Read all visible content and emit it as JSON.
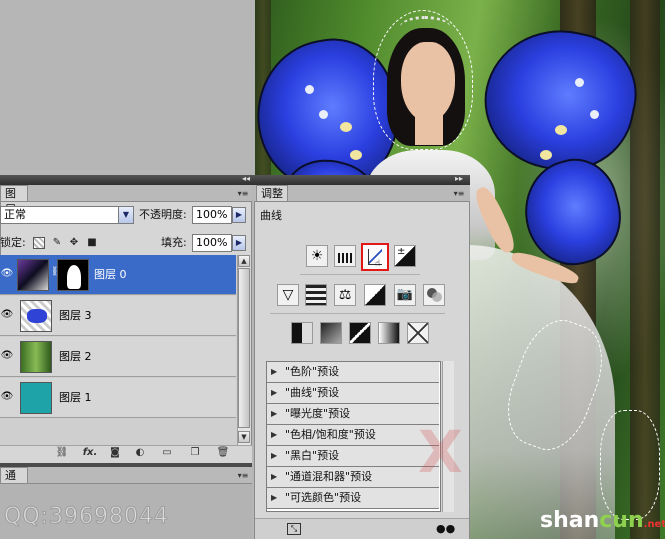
{
  "layers_panel": {
    "tab_label": "图层",
    "blend_mode": "正常",
    "opacity_label": "不透明度:",
    "opacity_value": "100%",
    "lock_label": "锁定:",
    "fill_label": "填充:",
    "fill_value": "100%",
    "layers": [
      {
        "name": "图层 0",
        "selected": true
      },
      {
        "name": "图层 3",
        "selected": false
      },
      {
        "name": "图层 2",
        "selected": false
      },
      {
        "name": "图层 1",
        "selected": false
      }
    ],
    "thumb_colors": {
      "layer1": "#1ea3a8"
    },
    "fx_label": "fx."
  },
  "channels_panel": {
    "tab_label": "通道"
  },
  "adjustments_panel": {
    "tab_label": "调整",
    "current_adjustment": "曲线",
    "icons_row1": [
      "brightness-contrast-icon",
      "levels-icon",
      "curves-icon",
      "exposure-icon"
    ],
    "icons_row2": [
      "vibrance-icon",
      "hue-saturation-icon",
      "color-balance-icon",
      "black-white-icon",
      "photo-filter-icon",
      "channel-mixer-icon"
    ],
    "icons_row3": [
      "invert-icon",
      "posterize-icon",
      "threshold-icon",
      "gradient-map-icon",
      "selective-color-icon"
    ],
    "highlight_color": "#e21818",
    "presets": [
      "\"色阶\"预设",
      "\"曲线\"预设",
      "\"曝光度\"预设",
      "\"色相/饱和度\"预设",
      "\"黑白\"预设",
      "\"通道混和器\"预设",
      "\"可选颜色\"预设"
    ]
  },
  "watermarks": {
    "qq": "QQ:39698044",
    "site_prefix": "shan",
    "site_suffix": "cun",
    "site_domain": ".net",
    "x_mark": "X"
  }
}
